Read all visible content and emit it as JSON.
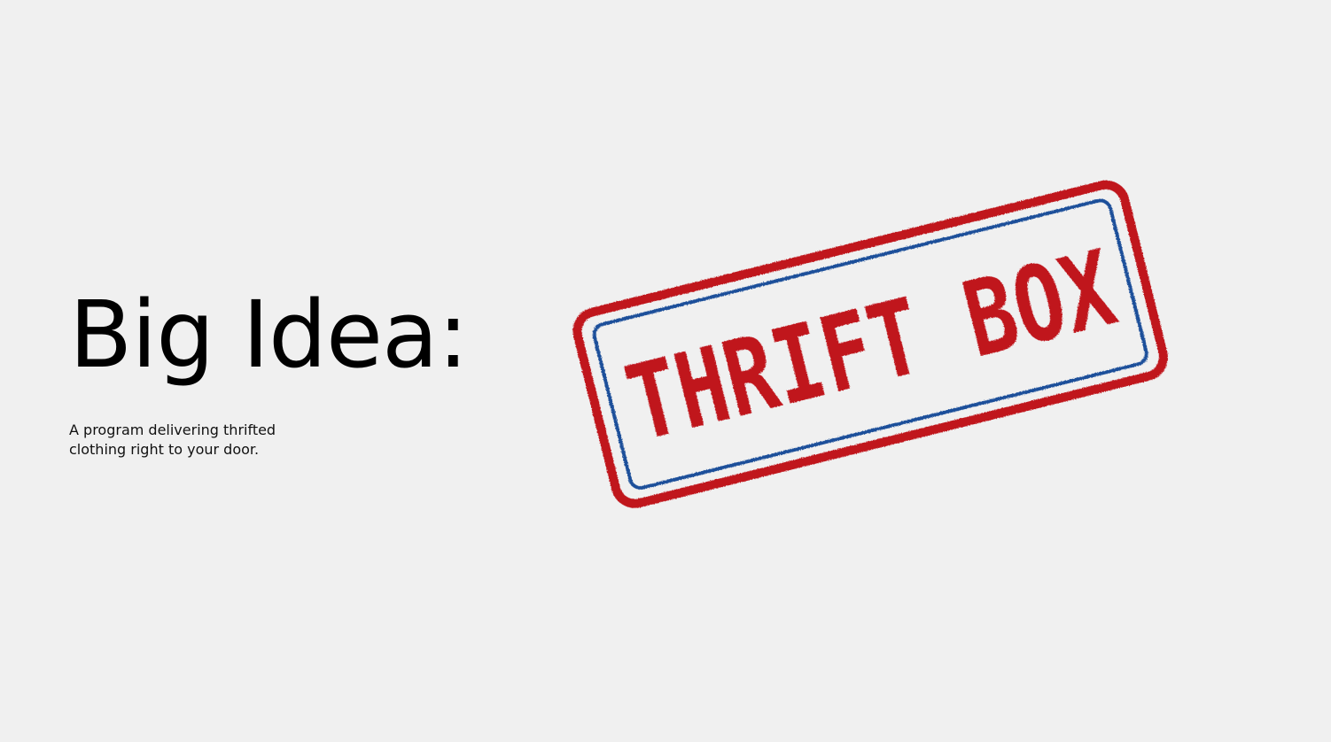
{
  "slide": {
    "title": "Big Idea:",
    "subtitle": "A program delivering thrifted clothing right to your door."
  },
  "stamp": {
    "text": "THRIFT BOX",
    "icon": "thrift-box-stamp",
    "colors": {
      "text": "#c0151f",
      "outer_border": "#c0151f",
      "inner_border": "#1d4f9a"
    }
  },
  "colors": {
    "background": "#f0f0f0",
    "title": "#000000"
  }
}
